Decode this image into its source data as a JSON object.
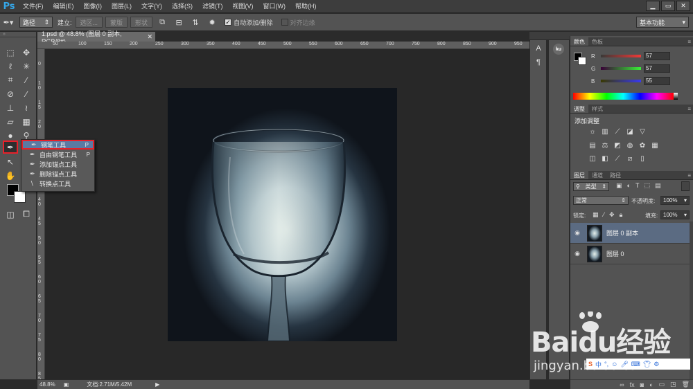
{
  "app": {
    "logo": "Ps"
  },
  "menu": [
    "文件(F)",
    "编辑(E)",
    "图像(I)",
    "图层(L)",
    "文字(Y)",
    "选择(S)",
    "滤镜(T)",
    "视图(V)",
    "窗口(W)",
    "帮助(H)"
  ],
  "window_controls": [
    "▁",
    "▭",
    "✕"
  ],
  "options_bar": {
    "mode_select": "路径",
    "make_label": "建立:",
    "btn_selection": "选区...",
    "btn_mask": "蒙版",
    "btn_shape": "形状",
    "auto_add_delete": "自动添加/删除",
    "align_edges": "对齐边缘",
    "workspace": "基本功能"
  },
  "document": {
    "tab_title": "1.psd @ 48.8% (图层 0 副本, RGB/8#)",
    "ruler_top": [
      "50",
      "100",
      "150",
      "200",
      "250",
      "300",
      "350",
      "400",
      "450",
      "500",
      "550",
      "600",
      "650",
      "700",
      "750",
      "800",
      "850",
      "900",
      "950"
    ],
    "ruler_left": [
      "0",
      "1\n0",
      "1\n5",
      "2\n0",
      "2\n5",
      "3\n0",
      "3\n5",
      "4\n0",
      "4\n5",
      "5\n0",
      "5\n5",
      "6\n0",
      "6\n5",
      "7\n0",
      "7\n5",
      "8\n0",
      "8\n5"
    ]
  },
  "status": {
    "zoom": "48.8%",
    "doc_info": "文档:2.71M/5.42M"
  },
  "flyout": {
    "items": [
      {
        "label": "钢笔工具",
        "key": "P",
        "icon": "pen-icon"
      },
      {
        "label": "自由钢笔工具",
        "key": "P",
        "icon": "freeform-pen-icon"
      },
      {
        "label": "添加锚点工具",
        "key": "",
        "icon": "add-anchor-icon"
      },
      {
        "label": "删除锚点工具",
        "key": "",
        "icon": "delete-anchor-icon"
      },
      {
        "label": "转换点工具",
        "key": "",
        "icon": "convert-point-icon"
      }
    ]
  },
  "color_panel": {
    "tabs": [
      "颜色",
      "色板"
    ],
    "channels": [
      {
        "label": "R",
        "value": "57"
      },
      {
        "label": "G",
        "value": "57"
      },
      {
        "label": "B",
        "value": "55"
      }
    ]
  },
  "adjust_panel": {
    "tabs": [
      "调整",
      "样式"
    ],
    "title": "添加调整"
  },
  "layers_panel": {
    "tabs": [
      "图层",
      "通道",
      "路径"
    ],
    "filter": "类型",
    "blend_mode": "正常",
    "opacity_label": "不透明度:",
    "opacity": "100%",
    "lock_label": "锁定:",
    "fill_label": "填充:",
    "fill": "100%",
    "layers": [
      {
        "name": "图层 0 副本",
        "active": true
      },
      {
        "name": "图层 0",
        "active": false
      }
    ]
  },
  "watermark": {
    "brand": "Baidu经验",
    "url": "jingyan.baidu.com"
  },
  "colors": {
    "ps_blue": "#35a6e8",
    "highlight_red": "#e8202a",
    "selected_layer": "#5b6b82",
    "menu_select": "#5b7aa3"
  }
}
